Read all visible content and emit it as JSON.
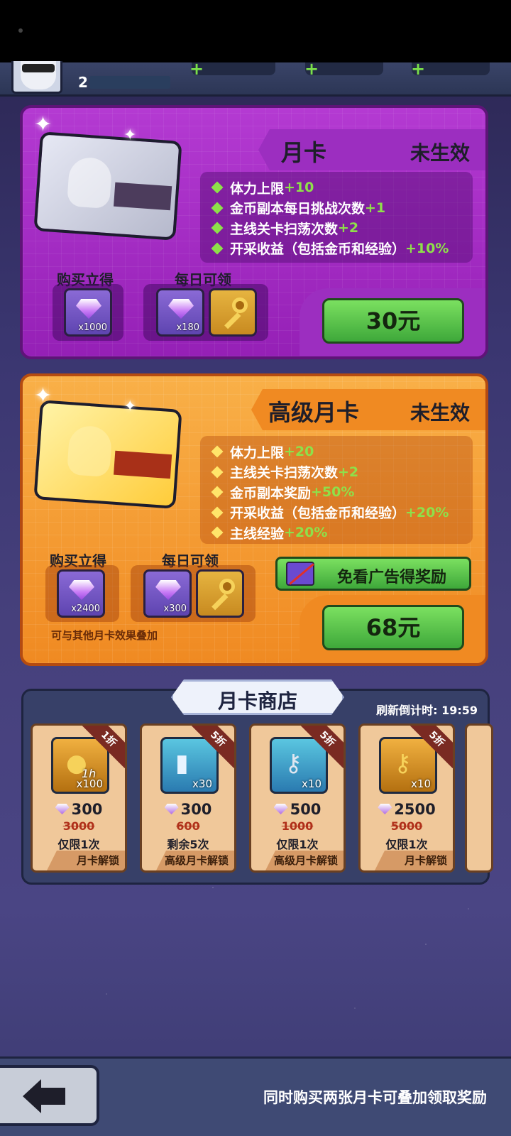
{
  "player": {
    "level": "2"
  },
  "cards": [
    {
      "title": "月卡",
      "status": "未生效",
      "perks": [
        {
          "text": "体力上限",
          "bonus": "+10"
        },
        {
          "text": "金币副本每日挑战次数",
          "bonus": "+1"
        },
        {
          "text": "主线关卡扫荡次数",
          "bonus": "+2"
        },
        {
          "text": "开采收益（包括金币和经验）",
          "bonus": "+10%"
        }
      ],
      "buy_label": "购买立得",
      "daily_label": "每日可领",
      "buy_qty": "x1000",
      "daily_qty": "x180",
      "price": "30元"
    },
    {
      "title": "高级月卡",
      "status": "未生效",
      "perks": [
        {
          "text": "体力上限",
          "bonus": "+20"
        },
        {
          "text": "主线关卡扫荡次数",
          "bonus": "+2"
        },
        {
          "text": "金币副本奖励",
          "bonus": "+50%"
        },
        {
          "text": "开采收益（包括金币和经验）",
          "bonus": "+20%"
        },
        {
          "text": "主线经验",
          "bonus": "+20%"
        }
      ],
      "buy_label": "购买立得",
      "daily_label": "每日可领",
      "buy_qty": "x2400",
      "daily_qty": "x300",
      "ad_label": "免看广告得奖励",
      "stack_note": "可与其他月卡效果叠加",
      "price": "68元"
    }
  ],
  "shop": {
    "title": "月卡商店",
    "refresh_label": "刷新倒计时:",
    "refresh_time": "19:59",
    "items": [
      {
        "discount": "1折",
        "icon": "coin-bag-icon",
        "sub": "1h",
        "qty": "x100",
        "price": "300",
        "old_price": "3000",
        "limit": "仅限1次",
        "unlock": "月卡解锁"
      },
      {
        "discount": "5折",
        "icon": "battery-icon",
        "qty": "x30",
        "price": "300",
        "old_price": "600",
        "limit": "剩余5次",
        "unlock": "高级月卡解锁"
      },
      {
        "discount": "5折",
        "icon": "silver-key-icon",
        "qty": "x10",
        "price": "500",
        "old_price": "1000",
        "limit": "仅限1次",
        "unlock": "高级月卡解锁"
      },
      {
        "discount": "5折",
        "icon": "gold-key-icon",
        "qty": "x10",
        "price": "2500",
        "old_price": "5000",
        "limit": "仅限1次",
        "unlock": "月卡解锁"
      }
    ]
  },
  "footer": {
    "note": "同时购买两张月卡可叠加领取奖励"
  },
  "colors": {
    "purple_card": "#9520b6",
    "orange_card": "#f08a22",
    "buy_button": "#3ea83a"
  }
}
